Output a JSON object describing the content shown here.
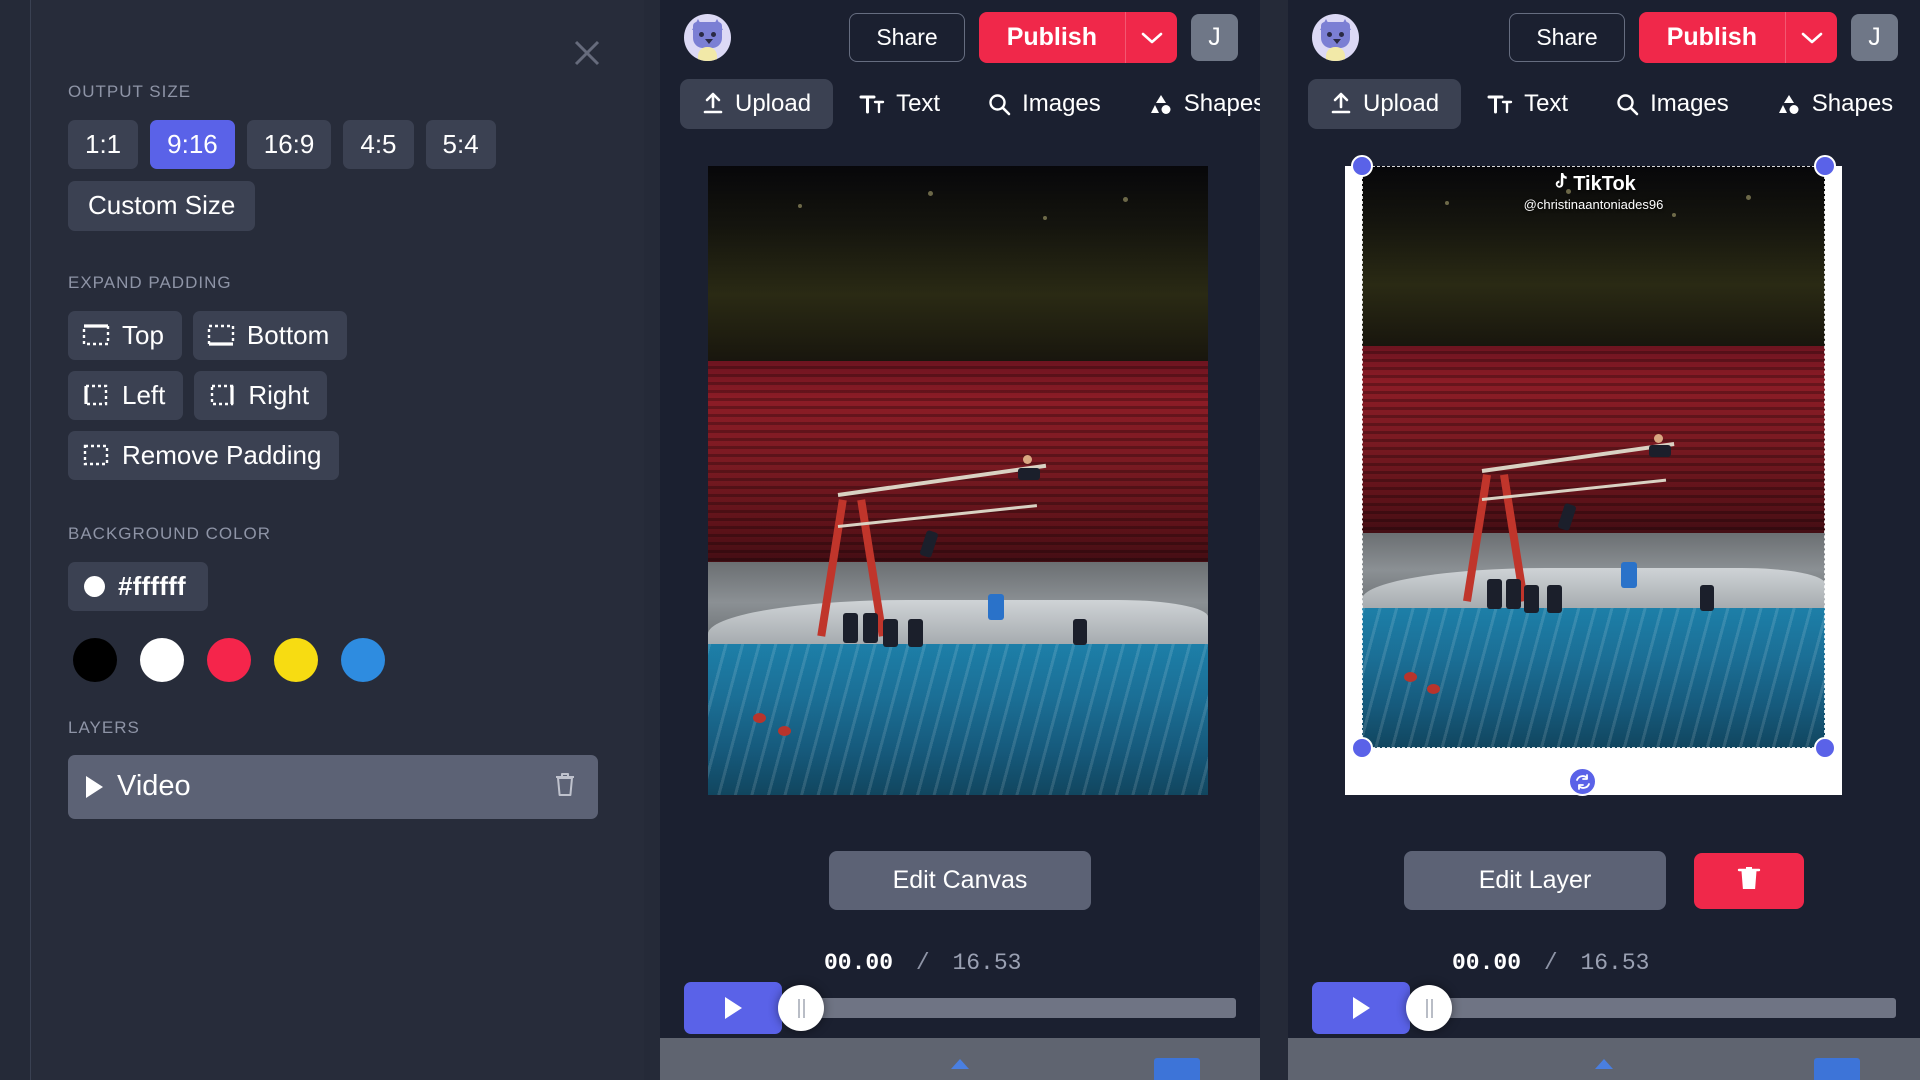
{
  "left_panel": {
    "close_icon": "close-icon",
    "sections": {
      "output_size": {
        "label": "OUTPUT SIZE",
        "options": [
          "1:1",
          "9:16",
          "16:9",
          "4:5",
          "5:4"
        ],
        "selected": "9:16",
        "custom_label": "Custom Size",
        "active_color": "#5a62e8"
      },
      "expand_padding": {
        "label": "EXPAND PADDING",
        "buttons": [
          {
            "label": "Top",
            "icon": "padding-top-icon"
          },
          {
            "label": "Bottom",
            "icon": "padding-bottom-icon"
          },
          {
            "label": "Left",
            "icon": "padding-left-icon"
          },
          {
            "label": "Right",
            "icon": "padding-right-icon"
          },
          {
            "label": "Remove Padding",
            "icon": "padding-remove-icon"
          }
        ]
      },
      "background_color": {
        "label": "BACKGROUND COLOR",
        "current_hex": "#ffffff",
        "swatches": [
          "#000000",
          "#ffffff",
          "#f5254b",
          "#f7dc12",
          "#2e8ce0"
        ]
      },
      "layers": {
        "label": "LAYERS",
        "items": [
          {
            "name": "Video",
            "expand_icon": "triangle-right-icon",
            "delete_icon": "trash-icon"
          }
        ]
      }
    }
  },
  "app": {
    "header": {
      "avatar_icon": "cat-avatar-icon",
      "share_label": "Share",
      "publish_label": "Publish",
      "publish_caret_icon": "chevron-down-icon",
      "user_initial": "J",
      "publish_color": "#f0284a"
    },
    "toolbar": [
      {
        "label": "Upload",
        "icon": "upload-icon",
        "active": true
      },
      {
        "label": "Text",
        "icon": "text-icon",
        "active": false
      },
      {
        "label": "Images",
        "icon": "search-icon",
        "active": false
      },
      {
        "label": "Shapes",
        "icon": "shapes-icon",
        "active": false
      }
    ],
    "middle_panel": {
      "primary_action": "Edit Canvas"
    },
    "right_panel": {
      "primary_action": "Edit Layer",
      "delete_icon": "trash-icon",
      "rotate_icon": "rotate-icon",
      "watermark": {
        "brand": "TikTok",
        "handle": "@christinaantoniades96",
        "logo_icon": "tiktok-note-icon"
      }
    },
    "timeline": {
      "play_icon": "play-icon",
      "current_time": "00.00",
      "separator": "/",
      "duration": "16.53"
    }
  }
}
